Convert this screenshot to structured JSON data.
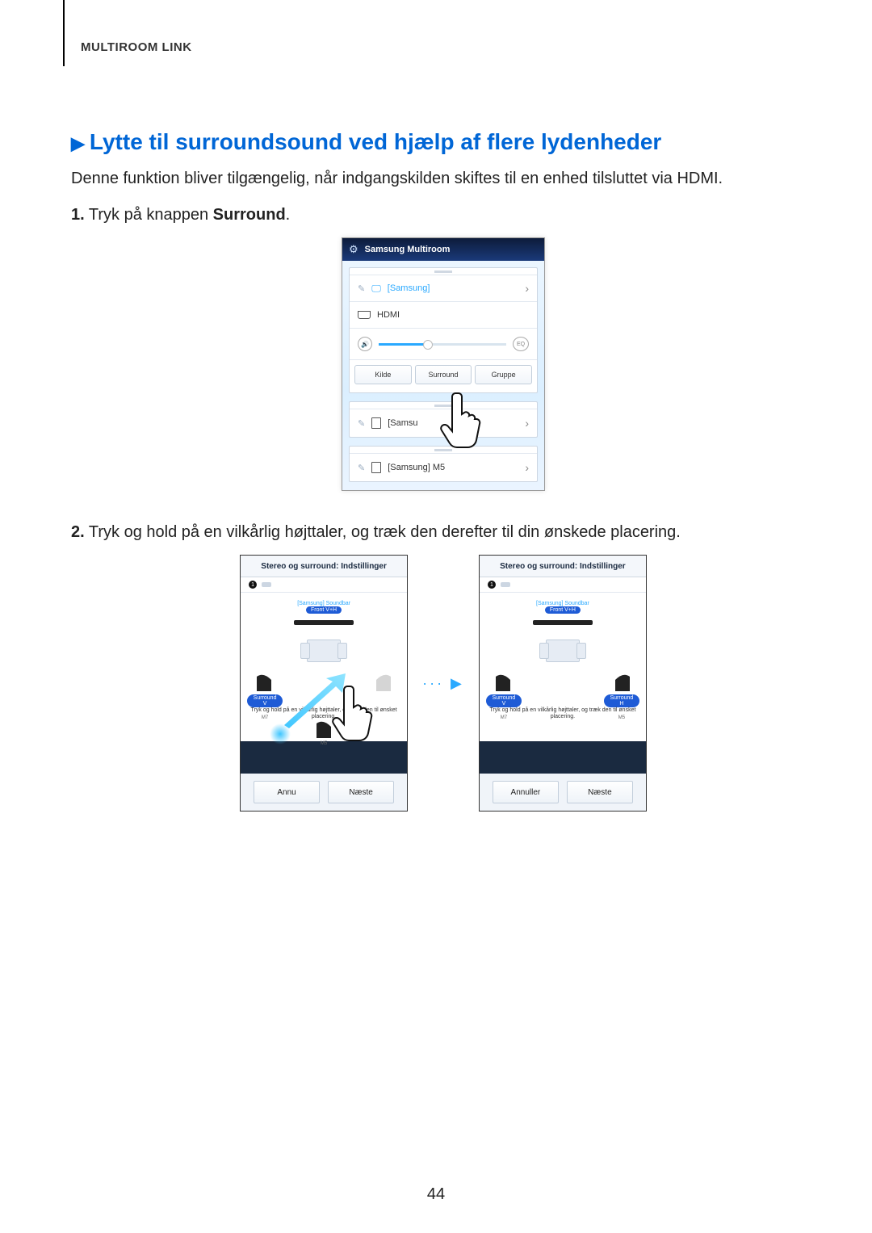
{
  "section_label": "MULTIROOM LINK",
  "heading_arrow": "▶",
  "heading": "Lytte til surroundsound ved hjælp af flere lydenheder",
  "intro": "Denne funktion bliver tilgængelig, når indgangskilden skiftes til en enhed tilsluttet via HDMI.",
  "step1_num": "1.",
  "step1_text_a": " Tryk på knappen ",
  "step1_bold": "Surround",
  "step1_text_b": ".",
  "step2_num": "2.",
  "step2_text": " Tryk og hold på en vilkårlig højttaler, og træk den derefter til din ønskede placering.",
  "page_number": "44",
  "arrow_dots": "··· ▶",
  "phone1": {
    "top_title": "Samsung Multiroom",
    "row_brand": "[Samsung]",
    "row_hdmi": "HDMI",
    "eq_label": "EQ",
    "btn_source": "Kilde",
    "btn_surround": "Surround",
    "btn_group": "Gruppe",
    "row_spk1": "[Samsu",
    "row_spk2": "[Samsung] M5"
  },
  "phone2": {
    "header": "Stereo og surround: Indstillinger",
    "dot_num": "1",
    "soundbar_label": "[Samsung] Soundbar",
    "badge_front": "Front V+H",
    "badge_surround_l": "Surround V",
    "badge_surround_r": "Surround H",
    "model_l": "M7",
    "model_r": "M5",
    "model_b": "M5",
    "hint": "Tryk og hold på en vilkårlig højttaler, og træk den til ønsket placering.",
    "btn_cancel_cut": "Annu",
    "btn_cancel": "Annuller",
    "btn_next": "Næste"
  }
}
